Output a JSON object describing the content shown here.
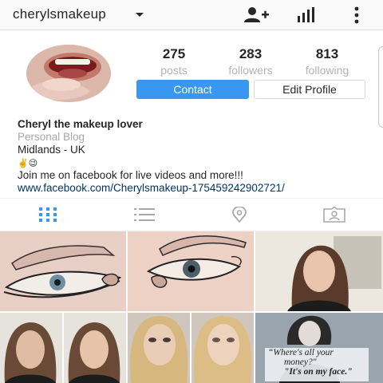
{
  "header": {
    "username": "cherylsmakeup",
    "icons": [
      "add-person-icon",
      "insights-icon",
      "more-icon"
    ]
  },
  "profile": {
    "stats": [
      {
        "value": "275",
        "label": "posts"
      },
      {
        "value": "283",
        "label": "followers"
      },
      {
        "value": "813",
        "label": "following"
      }
    ],
    "contact_label": "Contact",
    "edit_label": "Edit Profile"
  },
  "bio": {
    "name": "Cheryl the makeup lover",
    "category": "Personal Blog",
    "location": "Midlands - UK",
    "emojis": "✌️😉",
    "text": "Join me on facebook for live videos and more!!!",
    "link": "www.facebook.com/Cherylsmakeup-175459242902721/"
  },
  "tabs": [
    "grid-view-icon",
    "list-view-icon",
    "location-icon",
    "tagged-icon"
  ],
  "grid": {
    "quote_line1": "Where's all your",
    "quote_line2": "money?\"",
    "quote_line3": "\"It's on my face.\""
  },
  "colors": {
    "accent": "#3897f0",
    "link": "#003569",
    "muted": "#a8a8a8"
  }
}
